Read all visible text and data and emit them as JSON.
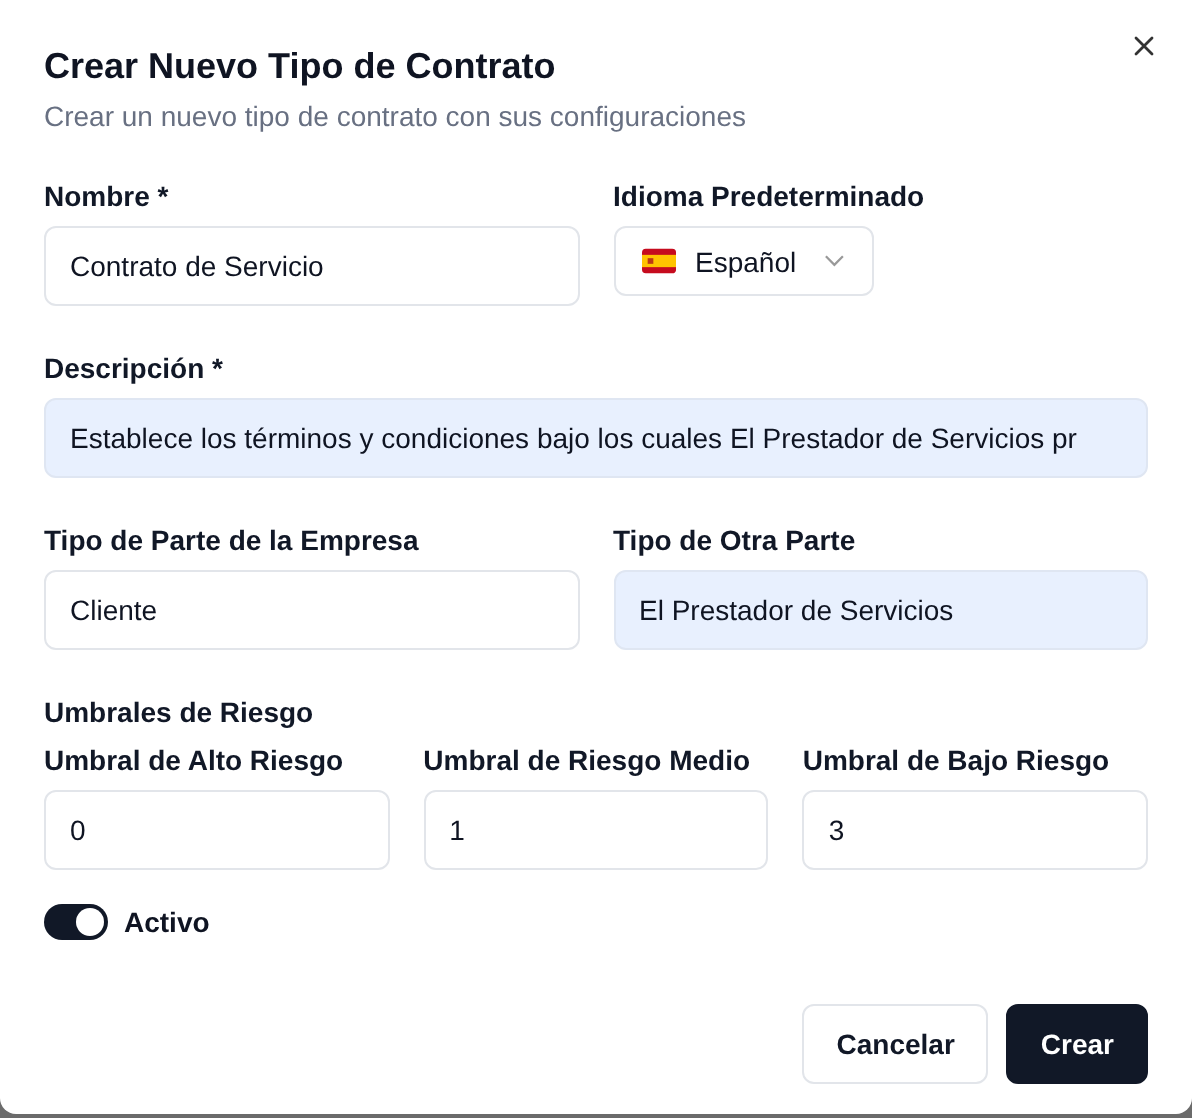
{
  "dialog": {
    "title": "Crear Nuevo Tipo de Contrato",
    "subtitle": "Crear un nuevo tipo de contrato con sus configuraciones"
  },
  "fields": [
    {
      "kind": "text",
      "label": "Nombre *",
      "value": "Contrato de Servicio",
      "highlighted": false
    },
    {
      "kind": "select",
      "label": "Idioma Predeterminado",
      "value": "Español"
    },
    {
      "kind": "text",
      "label": "Descripción *",
      "value": "Establece los términos y condiciones bajo los cuales El Prestador de Servicios pr",
      "highlighted": true
    },
    {
      "kind": "text",
      "label": "Tipo de Parte de la Empresa",
      "value": "Cliente",
      "highlighted": false
    },
    {
      "kind": "text",
      "label": "Tipo de Otra Parte",
      "value": "El Prestador de Servicios",
      "highlighted": true
    }
  ],
  "risk_thresholds": {
    "title": "Umbrales de Riesgo",
    "fields": [
      {
        "label": "Umbral de Alto Riesgo",
        "value": "0"
      },
      {
        "label": "Umbral de Riesgo Medio",
        "value": "1"
      },
      {
        "label": "Umbral de Bajo Riesgo",
        "value": "3"
      }
    ]
  },
  "active_toggle": {
    "label": "Activo",
    "on": true
  },
  "buttons": [
    {
      "kind": "secondary",
      "label": "Cancelar"
    },
    {
      "kind": "primary",
      "label": "Crear"
    }
  ]
}
